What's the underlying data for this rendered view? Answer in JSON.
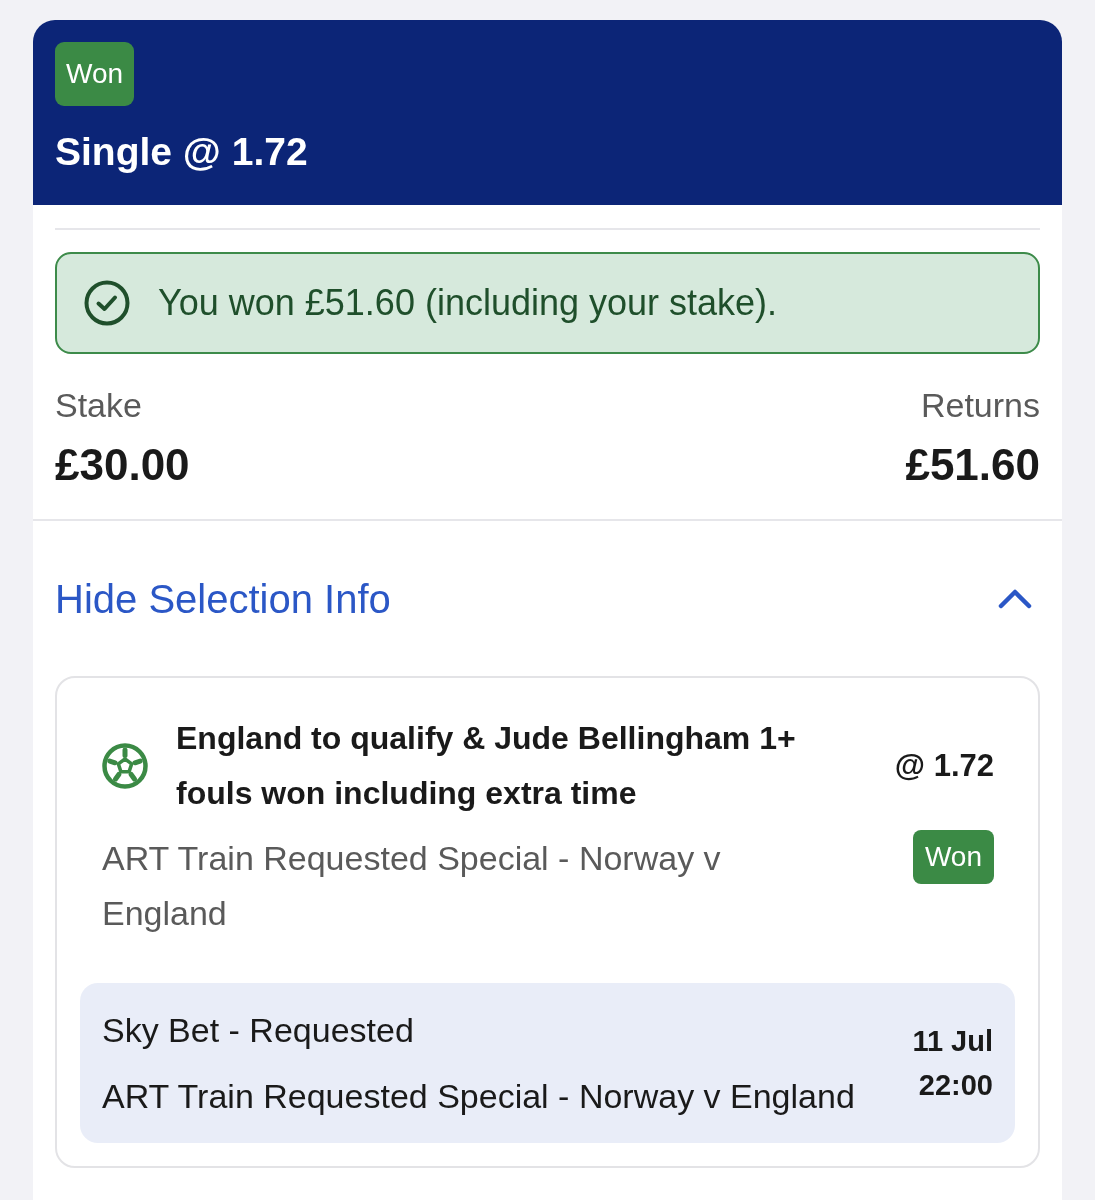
{
  "bet": {
    "status": {
      "label": "Won",
      "kind": "won"
    },
    "title": "Single @ 1.72"
  },
  "result_banner": {
    "kind": "success",
    "message": "You won £51.60 (including your stake)."
  },
  "summary": [
    {
      "label": "Stake",
      "value": "£30.00"
    },
    {
      "label": "Returns",
      "value": "£51.60"
    }
  ],
  "selection_toggle": {
    "label": "Hide Selection Info",
    "expanded": true
  },
  "selections": [
    {
      "kind": "football",
      "market": "England to qualify & Jude Bellingham 1+ fouls won including extra time",
      "odds": "@ 1.72",
      "event": "ART Train Requested Special - Norway v England",
      "status": {
        "label": "Won",
        "kind": "won"
      },
      "details": {
        "line_1": "Sky Bet - Requested",
        "line_2": "ART Train Requested Special - Norway v England",
        "date": "11 Jul",
        "time": "22:00"
      }
    }
  ]
}
